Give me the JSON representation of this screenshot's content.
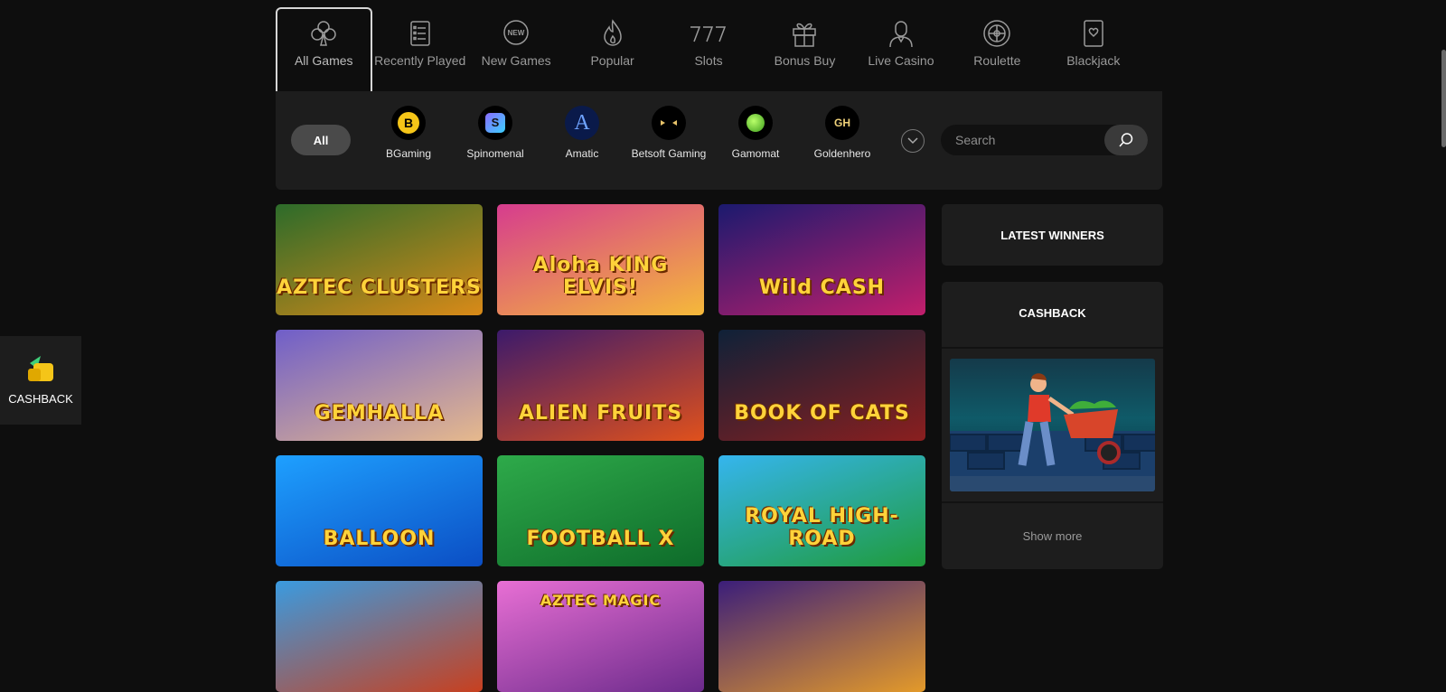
{
  "categories": [
    {
      "label": "All Games",
      "icon": "club-icon",
      "active": true
    },
    {
      "label": "Recently Played",
      "icon": "list-icon"
    },
    {
      "label": "New Games",
      "icon": "new-badge-icon"
    },
    {
      "label": "Popular",
      "icon": "flame-icon"
    },
    {
      "label": "Slots",
      "icon": "777-icon"
    },
    {
      "label": "Bonus Buy",
      "icon": "gift-icon"
    },
    {
      "label": "Live Casino",
      "icon": "dealer-icon"
    },
    {
      "label": "Roulette",
      "icon": "roulette-icon"
    },
    {
      "label": "Blackjack",
      "icon": "card-icon"
    }
  ],
  "providers": {
    "all_label": "All",
    "items": [
      {
        "label": "BGaming",
        "logo": "B"
      },
      {
        "label": "Spinomenal",
        "logo": "S"
      },
      {
        "label": "Amatic",
        "logo": "A"
      },
      {
        "label": "Betsoft Gaming",
        "logo": ""
      },
      {
        "label": "Gamomat",
        "logo": ""
      },
      {
        "label": "Goldenhero",
        "logo": "GH"
      }
    ]
  },
  "search": {
    "placeholder": "Search"
  },
  "games": [
    {
      "title": "AZTEC CLUSTERS",
      "colors": [
        "#2c6b2a",
        "#d98a18"
      ]
    },
    {
      "title": "Aloha KING ELVIS!",
      "colors": [
        "#d63c8e",
        "#f5b93a"
      ]
    },
    {
      "title": "Wild CASH",
      "colors": [
        "#1b1a6e",
        "#c21f6c"
      ]
    },
    {
      "title": "GEMHALLA",
      "colors": [
        "#6f5ec9",
        "#e6b98c"
      ]
    },
    {
      "title": "ALIEN FRUITS",
      "colors": [
        "#3c1a6b",
        "#e0511c"
      ]
    },
    {
      "title": "BOOK OF CATS",
      "colors": [
        "#0f2138",
        "#8a1f1f"
      ]
    },
    {
      "title": "BALLOON",
      "colors": [
        "#1ea0ff",
        "#0b4ec4"
      ]
    },
    {
      "title": "FOOTBALL X",
      "colors": [
        "#2eaa4a",
        "#0e6b2a"
      ]
    },
    {
      "title": "ROYAL HIGH-ROAD",
      "colors": [
        "#35b5ee",
        "#1f9b3b"
      ]
    },
    {
      "title": "",
      "colors": [
        "#3a9be0",
        "#c8401f"
      ]
    },
    {
      "title": "AZTEC MAGIC",
      "colors": [
        "#e86fd4",
        "#6b2a8b"
      ]
    },
    {
      "title": "",
      "colors": [
        "#3b1e7a",
        "#e39a2a"
      ]
    }
  ],
  "sidebar": {
    "latest_winners": "LATEST WINNERS",
    "cashback_title": "CASHBACK",
    "show_more": "Show more"
  },
  "floating_cashback": {
    "label": "CASHBACK"
  }
}
